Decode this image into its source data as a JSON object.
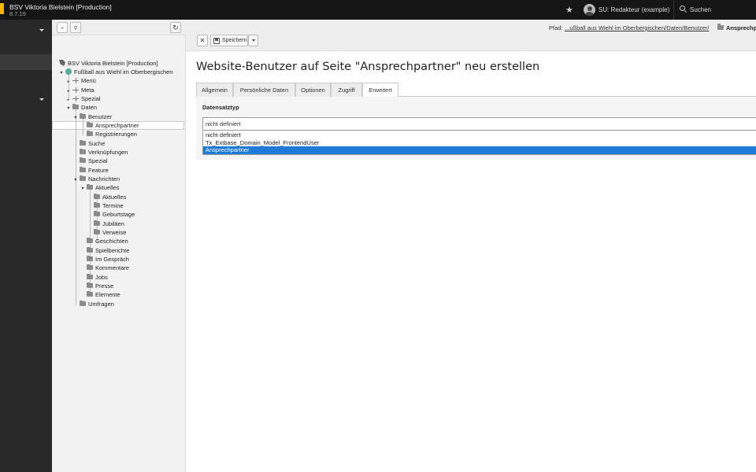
{
  "topbar": {
    "site_name": "BSV Viktoria Bielstein [Production]",
    "version": "8.7.19",
    "user": "SU: Redakteur (example)",
    "search_label": "Suchen"
  },
  "docheader": {
    "path_label": "Pfad:",
    "path_link": "...ußball aus Wiehl im Oberbergischen/Daten/Benutzer/",
    "path_page": "Ansprechp",
    "save_label": "Speichern"
  },
  "tree": {
    "root": "BSV Viktoria Bielstein [Production]",
    "nodes": [
      "Fußball aus Wiehl im Oberbergischen",
      "Menü",
      "Meta",
      "Spezial",
      "Daten",
      "Benutzer",
      "Ansprechpartner",
      "Registrierungen",
      "Suche",
      "Verknüpfungen",
      "Spezial",
      "Feature",
      "Nachrichten",
      "Aktuelles",
      "Aktuelles",
      "Termine",
      "Geburtstage",
      "Jubiläen",
      "Verweise",
      "Geschichten",
      "Spielberichte",
      "Im Gespräch",
      "Kommentare",
      "Jobs",
      "Presse",
      "Elemente",
      "Umfragen"
    ]
  },
  "main": {
    "title": "Website-Benutzer auf Seite \"Ansprechpartner\" neu erstellen",
    "tabs": [
      "Allgemein",
      "Persönliche Daten",
      "Optionen",
      "Zugriff",
      "Erweitert"
    ],
    "active_tab": "Erweitert",
    "field_label": "Datensatztyp",
    "select_value": "nicht definiert",
    "options": [
      "nicht definiert",
      "Tx_Extbase_Domain_Model_FrontendUser",
      "Ansprechpartner"
    ],
    "highlighted_option": "Ansprechpartner"
  },
  "colors": {
    "topbar": "#151515",
    "module_menu": "#292929",
    "accent_logo": "#f5b800",
    "selection": "#1e7ad6"
  }
}
